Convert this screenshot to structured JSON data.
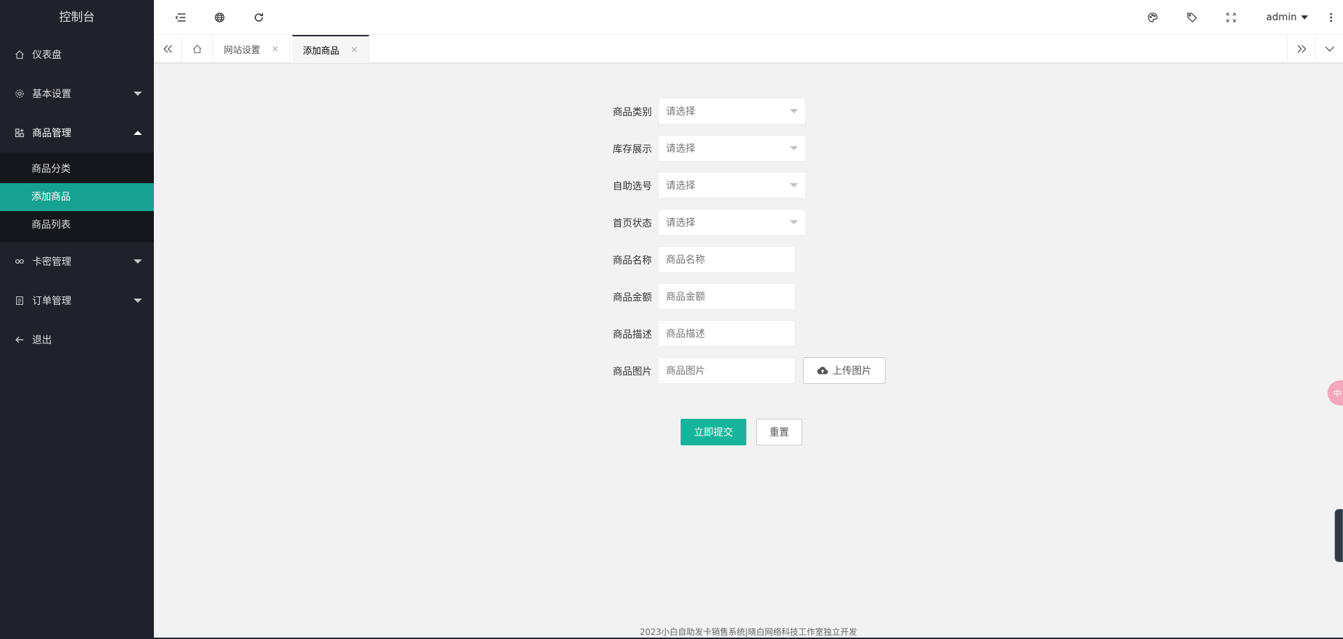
{
  "sidebar": {
    "title": "控制台",
    "items": [
      {
        "label": "仪表盘",
        "icon": "home-icon"
      },
      {
        "label": "基本设置",
        "icon": "gear-icon"
      },
      {
        "label": "商品管理",
        "icon": "grid-icon",
        "open": true,
        "children": [
          {
            "label": "商品分类"
          },
          {
            "label": "添加商品",
            "active": true
          },
          {
            "label": "商品列表"
          }
        ]
      },
      {
        "label": "卡密管理",
        "icon": "link-icon"
      },
      {
        "label": "订单管理",
        "icon": "list-icon"
      },
      {
        "label": "退出",
        "icon": "arrow-left-icon"
      }
    ]
  },
  "header": {
    "user": "admin"
  },
  "tabs": {
    "items": [
      {
        "label": "网站设置"
      },
      {
        "label": "添加商品",
        "active": true
      }
    ],
    "close_glyph": "×"
  },
  "form": {
    "fields": [
      {
        "label": "商品类别",
        "type": "select",
        "placeholder": "请选择"
      },
      {
        "label": "库存展示",
        "type": "select",
        "placeholder": "请选择"
      },
      {
        "label": "自助选号",
        "type": "select",
        "placeholder": "请选择"
      },
      {
        "label": "首页状态",
        "type": "select",
        "placeholder": "请选择"
      },
      {
        "label": "商品名称",
        "type": "input",
        "placeholder": "商品名称"
      },
      {
        "label": "商品金额",
        "type": "input",
        "placeholder": "商品金额"
      },
      {
        "label": "商品描述",
        "type": "input",
        "placeholder": "商品描述"
      },
      {
        "label": "商品图片",
        "type": "input",
        "placeholder": "商品图片"
      }
    ],
    "upload_label": "上传图片",
    "submit_label": "立即提交",
    "reset_label": "重置"
  },
  "footer": {
    "text": "2023小白自助发卡销售系统|晓白网络科技工作室独立开发"
  },
  "float_badge": "中",
  "colors": {
    "sidebar_bg": "#20222a",
    "active_green": "#16a190",
    "submit_green": "#16b59b"
  }
}
